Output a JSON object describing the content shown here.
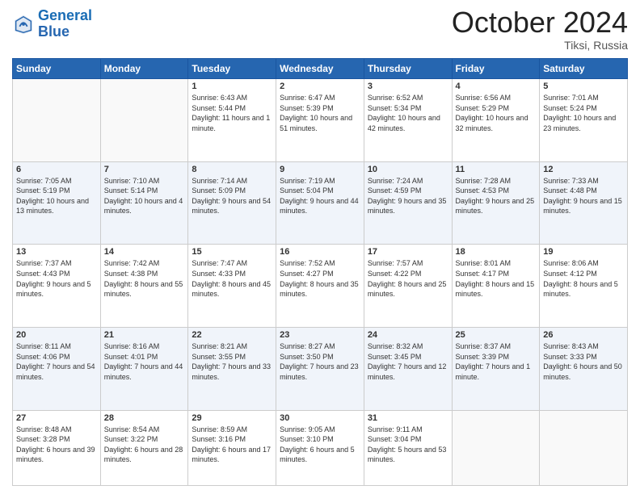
{
  "header": {
    "logo_general": "General",
    "logo_blue": "Blue",
    "month": "October 2024",
    "location": "Tiksi, Russia"
  },
  "weekdays": [
    "Sunday",
    "Monday",
    "Tuesday",
    "Wednesday",
    "Thursday",
    "Friday",
    "Saturday"
  ],
  "weeks": [
    [
      {
        "day": "",
        "sunrise": "",
        "sunset": "",
        "daylight": ""
      },
      {
        "day": "",
        "sunrise": "",
        "sunset": "",
        "daylight": ""
      },
      {
        "day": "1",
        "sunrise": "Sunrise: 6:43 AM",
        "sunset": "Sunset: 5:44 PM",
        "daylight": "Daylight: 11 hours and 1 minute."
      },
      {
        "day": "2",
        "sunrise": "Sunrise: 6:47 AM",
        "sunset": "Sunset: 5:39 PM",
        "daylight": "Daylight: 10 hours and 51 minutes."
      },
      {
        "day": "3",
        "sunrise": "Sunrise: 6:52 AM",
        "sunset": "Sunset: 5:34 PM",
        "daylight": "Daylight: 10 hours and 42 minutes."
      },
      {
        "day": "4",
        "sunrise": "Sunrise: 6:56 AM",
        "sunset": "Sunset: 5:29 PM",
        "daylight": "Daylight: 10 hours and 32 minutes."
      },
      {
        "day": "5",
        "sunrise": "Sunrise: 7:01 AM",
        "sunset": "Sunset: 5:24 PM",
        "daylight": "Daylight: 10 hours and 23 minutes."
      }
    ],
    [
      {
        "day": "6",
        "sunrise": "Sunrise: 7:05 AM",
        "sunset": "Sunset: 5:19 PM",
        "daylight": "Daylight: 10 hours and 13 minutes."
      },
      {
        "day": "7",
        "sunrise": "Sunrise: 7:10 AM",
        "sunset": "Sunset: 5:14 PM",
        "daylight": "Daylight: 10 hours and 4 minutes."
      },
      {
        "day": "8",
        "sunrise": "Sunrise: 7:14 AM",
        "sunset": "Sunset: 5:09 PM",
        "daylight": "Daylight: 9 hours and 54 minutes."
      },
      {
        "day": "9",
        "sunrise": "Sunrise: 7:19 AM",
        "sunset": "Sunset: 5:04 PM",
        "daylight": "Daylight: 9 hours and 44 minutes."
      },
      {
        "day": "10",
        "sunrise": "Sunrise: 7:24 AM",
        "sunset": "Sunset: 4:59 PM",
        "daylight": "Daylight: 9 hours and 35 minutes."
      },
      {
        "day": "11",
        "sunrise": "Sunrise: 7:28 AM",
        "sunset": "Sunset: 4:53 PM",
        "daylight": "Daylight: 9 hours and 25 minutes."
      },
      {
        "day": "12",
        "sunrise": "Sunrise: 7:33 AM",
        "sunset": "Sunset: 4:48 PM",
        "daylight": "Daylight: 9 hours and 15 minutes."
      }
    ],
    [
      {
        "day": "13",
        "sunrise": "Sunrise: 7:37 AM",
        "sunset": "Sunset: 4:43 PM",
        "daylight": "Daylight: 9 hours and 5 minutes."
      },
      {
        "day": "14",
        "sunrise": "Sunrise: 7:42 AM",
        "sunset": "Sunset: 4:38 PM",
        "daylight": "Daylight: 8 hours and 55 minutes."
      },
      {
        "day": "15",
        "sunrise": "Sunrise: 7:47 AM",
        "sunset": "Sunset: 4:33 PM",
        "daylight": "Daylight: 8 hours and 45 minutes."
      },
      {
        "day": "16",
        "sunrise": "Sunrise: 7:52 AM",
        "sunset": "Sunset: 4:27 PM",
        "daylight": "Daylight: 8 hours and 35 minutes."
      },
      {
        "day": "17",
        "sunrise": "Sunrise: 7:57 AM",
        "sunset": "Sunset: 4:22 PM",
        "daylight": "Daylight: 8 hours and 25 minutes."
      },
      {
        "day": "18",
        "sunrise": "Sunrise: 8:01 AM",
        "sunset": "Sunset: 4:17 PM",
        "daylight": "Daylight: 8 hours and 15 minutes."
      },
      {
        "day": "19",
        "sunrise": "Sunrise: 8:06 AM",
        "sunset": "Sunset: 4:12 PM",
        "daylight": "Daylight: 8 hours and 5 minutes."
      }
    ],
    [
      {
        "day": "20",
        "sunrise": "Sunrise: 8:11 AM",
        "sunset": "Sunset: 4:06 PM",
        "daylight": "Daylight: 7 hours and 54 minutes."
      },
      {
        "day": "21",
        "sunrise": "Sunrise: 8:16 AM",
        "sunset": "Sunset: 4:01 PM",
        "daylight": "Daylight: 7 hours and 44 minutes."
      },
      {
        "day": "22",
        "sunrise": "Sunrise: 8:21 AM",
        "sunset": "Sunset: 3:55 PM",
        "daylight": "Daylight: 7 hours and 33 minutes."
      },
      {
        "day": "23",
        "sunrise": "Sunrise: 8:27 AM",
        "sunset": "Sunset: 3:50 PM",
        "daylight": "Daylight: 7 hours and 23 minutes."
      },
      {
        "day": "24",
        "sunrise": "Sunrise: 8:32 AM",
        "sunset": "Sunset: 3:45 PM",
        "daylight": "Daylight: 7 hours and 12 minutes."
      },
      {
        "day": "25",
        "sunrise": "Sunrise: 8:37 AM",
        "sunset": "Sunset: 3:39 PM",
        "daylight": "Daylight: 7 hours and 1 minute."
      },
      {
        "day": "26",
        "sunrise": "Sunrise: 8:43 AM",
        "sunset": "Sunset: 3:33 PM",
        "daylight": "Daylight: 6 hours and 50 minutes."
      }
    ],
    [
      {
        "day": "27",
        "sunrise": "Sunrise: 8:48 AM",
        "sunset": "Sunset: 3:28 PM",
        "daylight": "Daylight: 6 hours and 39 minutes."
      },
      {
        "day": "28",
        "sunrise": "Sunrise: 8:54 AM",
        "sunset": "Sunset: 3:22 PM",
        "daylight": "Daylight: 6 hours and 28 minutes."
      },
      {
        "day": "29",
        "sunrise": "Sunrise: 8:59 AM",
        "sunset": "Sunset: 3:16 PM",
        "daylight": "Daylight: 6 hours and 17 minutes."
      },
      {
        "day": "30",
        "sunrise": "Sunrise: 9:05 AM",
        "sunset": "Sunset: 3:10 PM",
        "daylight": "Daylight: 6 hours and 5 minutes."
      },
      {
        "day": "31",
        "sunrise": "Sunrise: 9:11 AM",
        "sunset": "Sunset: 3:04 PM",
        "daylight": "Daylight: 5 hours and 53 minutes."
      },
      {
        "day": "",
        "sunrise": "",
        "sunset": "",
        "daylight": ""
      },
      {
        "day": "",
        "sunrise": "",
        "sunset": "",
        "daylight": ""
      }
    ]
  ]
}
